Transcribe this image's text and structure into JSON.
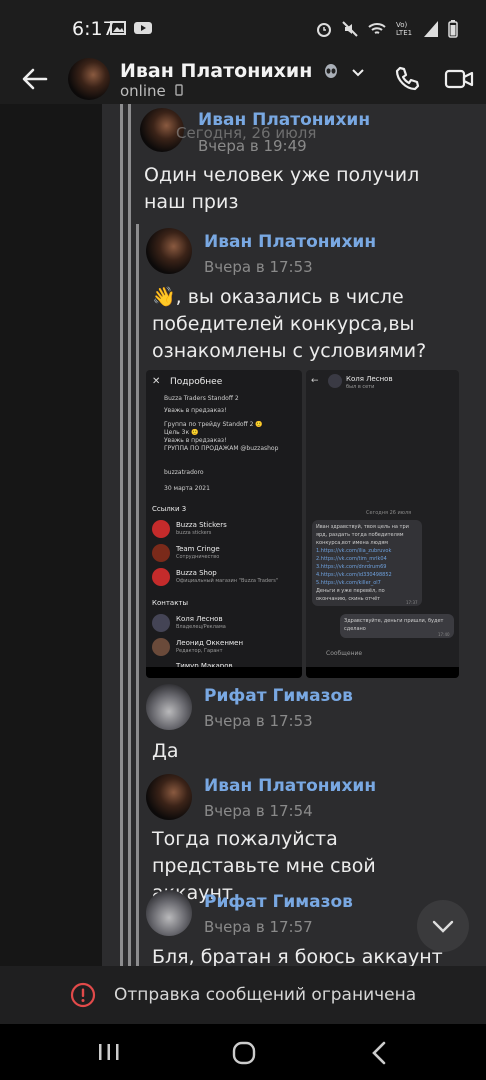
{
  "status_bar": {
    "time": "6:17",
    "network": "Vo) LTE1"
  },
  "header": {
    "name": "Иван Платонихин",
    "status": "online"
  },
  "date_overlay": "Сегодня, 26 июля",
  "quoted": {
    "name": "Иван Платонихин",
    "time": "Вчера в 19:49",
    "text": "Один человек уже получил наш приз"
  },
  "messages": [
    {
      "name": "Иван Платонихин",
      "time": "Вчера в 17:53",
      "text": "👋, вы оказались в числе победителей конкурса,вы ознакомлены с условиями?"
    },
    {
      "name": "Рифат Гимазов",
      "time": "Вчера в 17:53",
      "text": "Да"
    },
    {
      "name": "Иван Платонихин",
      "time": "Вчера в 17:54",
      "text": "Тогда пожалуйста представьте мне свой аккаунт"
    },
    {
      "name": "Рифат Гимазов",
      "time": "Вчера в 17:57",
      "text": "Бля, братан я боюсь аккаунт"
    }
  ],
  "screenshot_left": {
    "title": "Подробнее",
    "lines": [
      "Buzza Traders Standoff 2",
      "Уважь в предзаказ!",
      "Группа по трейду Standoff 2 🙂",
      "Цель 3к 🙂",
      "Уважь в предзаказ!",
      "ГРУППА ПО ПРОДАЖАМ @buzzashop",
      "buzzatradoro",
      "30 марта 2021"
    ],
    "links_header": "Ссылки 3",
    "links": [
      {
        "title": "Buzza Stickers",
        "sub": "buzza stickers"
      },
      {
        "title": "Team Cringe",
        "sub": "Сотрудничество"
      },
      {
        "title": "Buzza Shop",
        "sub": "Официальный магазин \"Buzza Traders\""
      }
    ],
    "contacts_header": "Контакты",
    "contacts": [
      {
        "title": "Коля Леснов",
        "sub": "Владелец/Реклама"
      },
      {
        "title": "Леонид Оккенмен",
        "sub": "Редактор, Гарант"
      },
      {
        "title": "Тимур Макаров",
        "sub": ""
      }
    ]
  },
  "screenshot_right": {
    "contact": "Коля Леснов",
    "status": "был в сети",
    "date": "Сегодня 26 июля",
    "incoming": [
      "Иван здравствуй, твоя цель на три",
      "ярд, раздать тогда победителям",
      "конкурса,вот имена людям",
      "1.https://vk.com/ilia_zubruvok",
      "2.https://vk.com/tim_mrlk04",
      "3.https://vk.com/dnrdrum69",
      "4.https://vk.com/id330498852",
      "5.https://vk.com/killer_ol7",
      "Деньги я уже перевёл, по",
      "окончанию, скинь отчёт"
    ],
    "incoming_time": "17:37",
    "outgoing": [
      "Здравствуйте, деньги пришли, будет",
      "сделано"
    ],
    "outgoing_time": "17:40",
    "input_placeholder": "Сообщение"
  },
  "banner": {
    "text": "Отправка сообщений ограничена"
  }
}
